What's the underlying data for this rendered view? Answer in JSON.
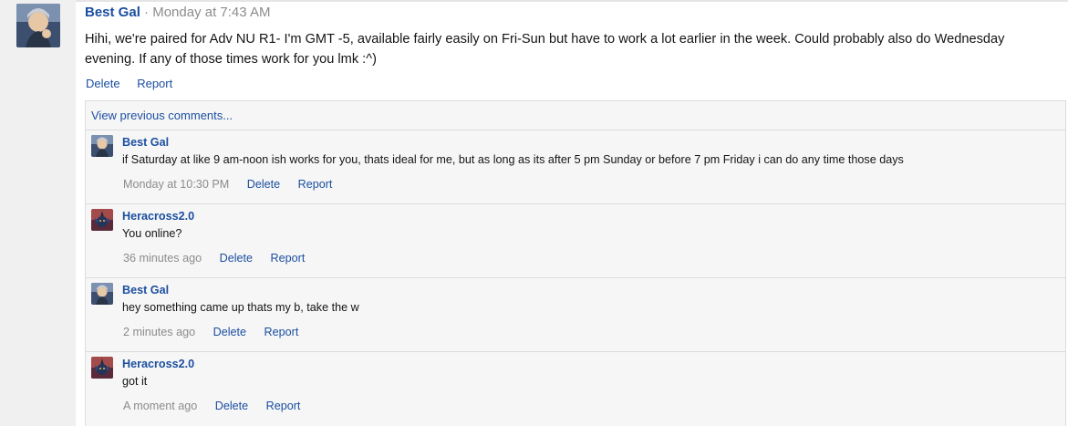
{
  "post": {
    "author": "Best Gal",
    "separator": "·",
    "timestamp": "Monday at 7:43 AM",
    "text": "Hihi, we're paired for Adv NU R1- I'm GMT -5, available fairly easily on Fri-Sun but have to work a lot earlier in the week. Could probably also do Wednesday evening. If any of those times work for you lmk :^)",
    "actions": {
      "delete": "Delete",
      "report": "Report"
    }
  },
  "comments_panel": {
    "view_previous": "View previous comments...",
    "items": [
      {
        "author": "Best Gal",
        "text": "if Saturday at like 9 am-noon ish works for you, thats ideal for me, but as long as its after 5 pm Sunday or before 7 pm Friday i can do any time those days",
        "time": "Monday at 10:30 PM",
        "delete": "Delete",
        "report": "Report"
      },
      {
        "author": "Heracross2.0",
        "text": "You online?",
        "time": "36 minutes ago",
        "delete": "Delete",
        "report": "Report"
      },
      {
        "author": "Best Gal",
        "text": "hey something came up thats my b, take the w",
        "time": "2 minutes ago",
        "delete": "Delete",
        "report": "Report"
      },
      {
        "author": "Heracross2.0",
        "text": "got it",
        "time": "A moment ago",
        "delete": "Delete",
        "report": "Report"
      }
    ]
  },
  "colors": {
    "link": "#1c4fa0",
    "muted": "#8c8c8c",
    "panel_bg": "#f6f6f6",
    "border": "#dcdcdc",
    "gutter_bg": "#f0f0f0"
  }
}
